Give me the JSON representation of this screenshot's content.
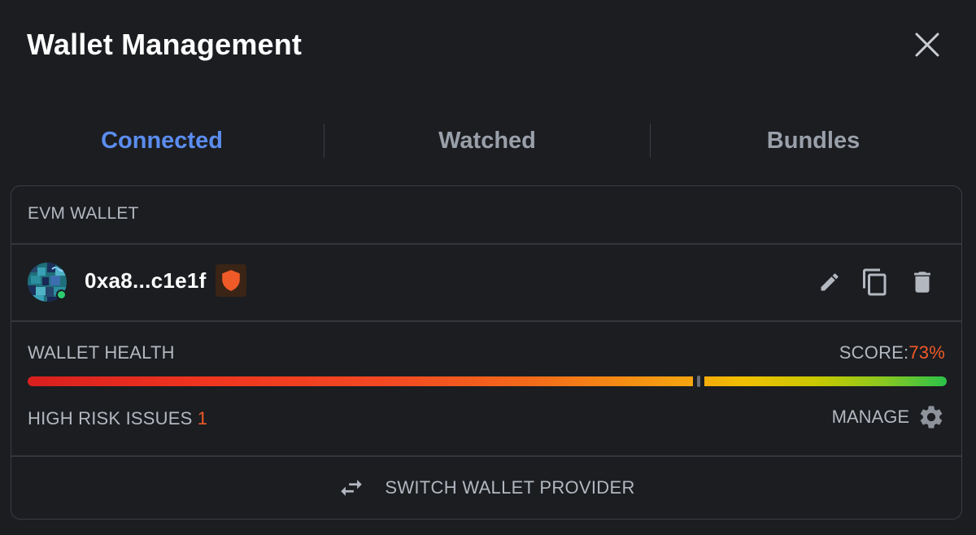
{
  "title": "Wallet Management",
  "tabs": [
    {
      "label": "Connected",
      "active": true
    },
    {
      "label": "Watched",
      "active": false
    },
    {
      "label": "Bundles",
      "active": false
    }
  ],
  "card": {
    "section_title": "EVM WALLET",
    "wallet": {
      "address": "0xa8...c1e1f",
      "status_color": "#2ecc71",
      "shield_color": "#f05a28",
      "actions": [
        "pencil-icon",
        "copy-icon",
        "trash-icon"
      ]
    },
    "health": {
      "label": "WALLET HEALTH",
      "score_label": "SCORE:",
      "score_value": "73%",
      "score_fraction": 0.73,
      "risk_label": "HIGH RISK ISSUES",
      "risk_count": "1",
      "manage_label": "MANAGE"
    },
    "switch_label": "SWITCH WALLET PROVIDER"
  },
  "colors": {
    "accent": "#5b8def",
    "risk": "#f05a28",
    "background": "#1b1d21"
  }
}
